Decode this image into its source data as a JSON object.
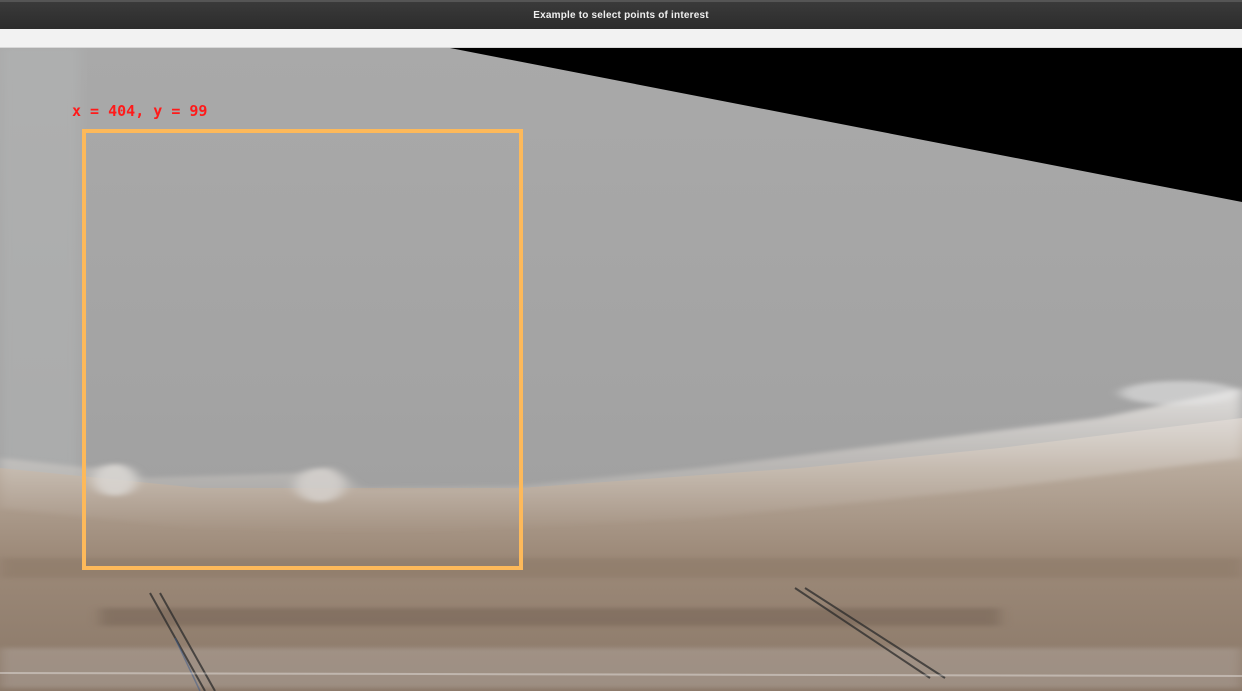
{
  "window": {
    "title": "Example to select points of interest"
  },
  "overlay": {
    "coordinate_text": "x = 404, y = 99",
    "label_color": "#ff1a1a",
    "selection_color": "#fdb95a"
  }
}
